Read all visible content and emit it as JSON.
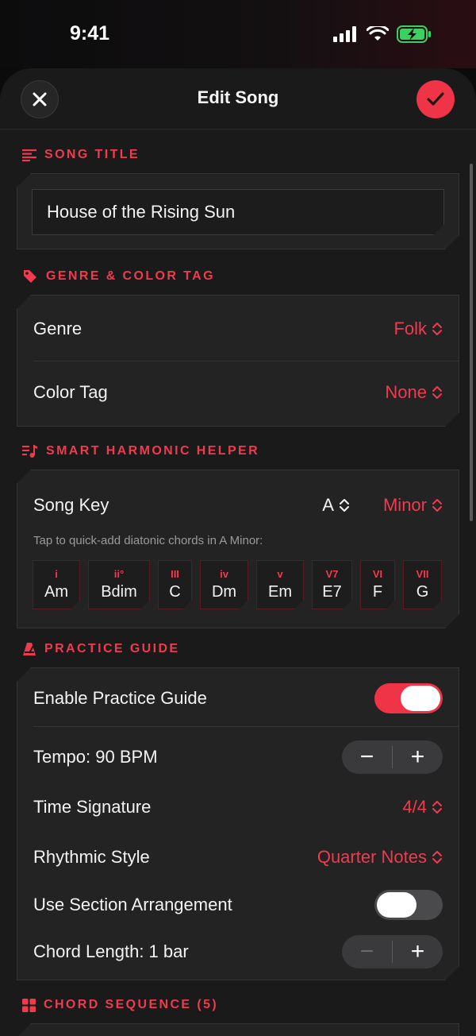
{
  "status": {
    "time": "9:41"
  },
  "nav": {
    "title": "Edit Song"
  },
  "sections": {
    "song_title": "SONG TITLE",
    "genre_color": "GENRE & COLOR TAG",
    "harmonic": "SMART HARMONIC HELPER",
    "practice": "PRACTICE GUIDE",
    "sequence": "CHORD SEQUENCE (5)"
  },
  "song": {
    "title_value": "House of the Rising Sun"
  },
  "genre": {
    "label": "Genre",
    "value": "Folk"
  },
  "color_tag": {
    "label": "Color Tag",
    "value": "None"
  },
  "harmonic": {
    "key_label": "Song Key",
    "key_note": "A",
    "key_mode": "Minor",
    "hint": "Tap to quick-add diatonic chords in A Minor:",
    "chords": [
      {
        "degree": "i",
        "name": "Am"
      },
      {
        "degree": "ii°",
        "name": "Bdim"
      },
      {
        "degree": "III",
        "name": "C"
      },
      {
        "degree": "iv",
        "name": "Dm"
      },
      {
        "degree": "v",
        "name": "Em"
      },
      {
        "degree": "V7",
        "name": "E7"
      },
      {
        "degree": "VI",
        "name": "F"
      },
      {
        "degree": "VII",
        "name": "G"
      }
    ]
  },
  "practice": {
    "enable_label": "Enable Practice Guide",
    "enable_on": true,
    "tempo_label": "Tempo: 90 BPM",
    "time_sig_label": "Time Signature",
    "time_sig_value": "4/4",
    "rhythm_label": "Rhythmic Style",
    "rhythm_value": "Quarter Notes",
    "arrangement_label": "Use Section Arrangement",
    "arrangement_on": false,
    "chord_length_label": "Chord Length: 1 bar"
  },
  "colors": {
    "accent": "#ef3b4d",
    "card": "#232324",
    "sheet": "#1a1a1b"
  },
  "icons": {
    "close": "close-icon",
    "save": "checkmark-icon",
    "title": "text-lines-icon",
    "tag": "tag-icon",
    "harmonic": "music-note-list-icon",
    "practice": "metronome-icon",
    "sequence": "grid-icon",
    "updown": "chevron-up-down-icon"
  }
}
